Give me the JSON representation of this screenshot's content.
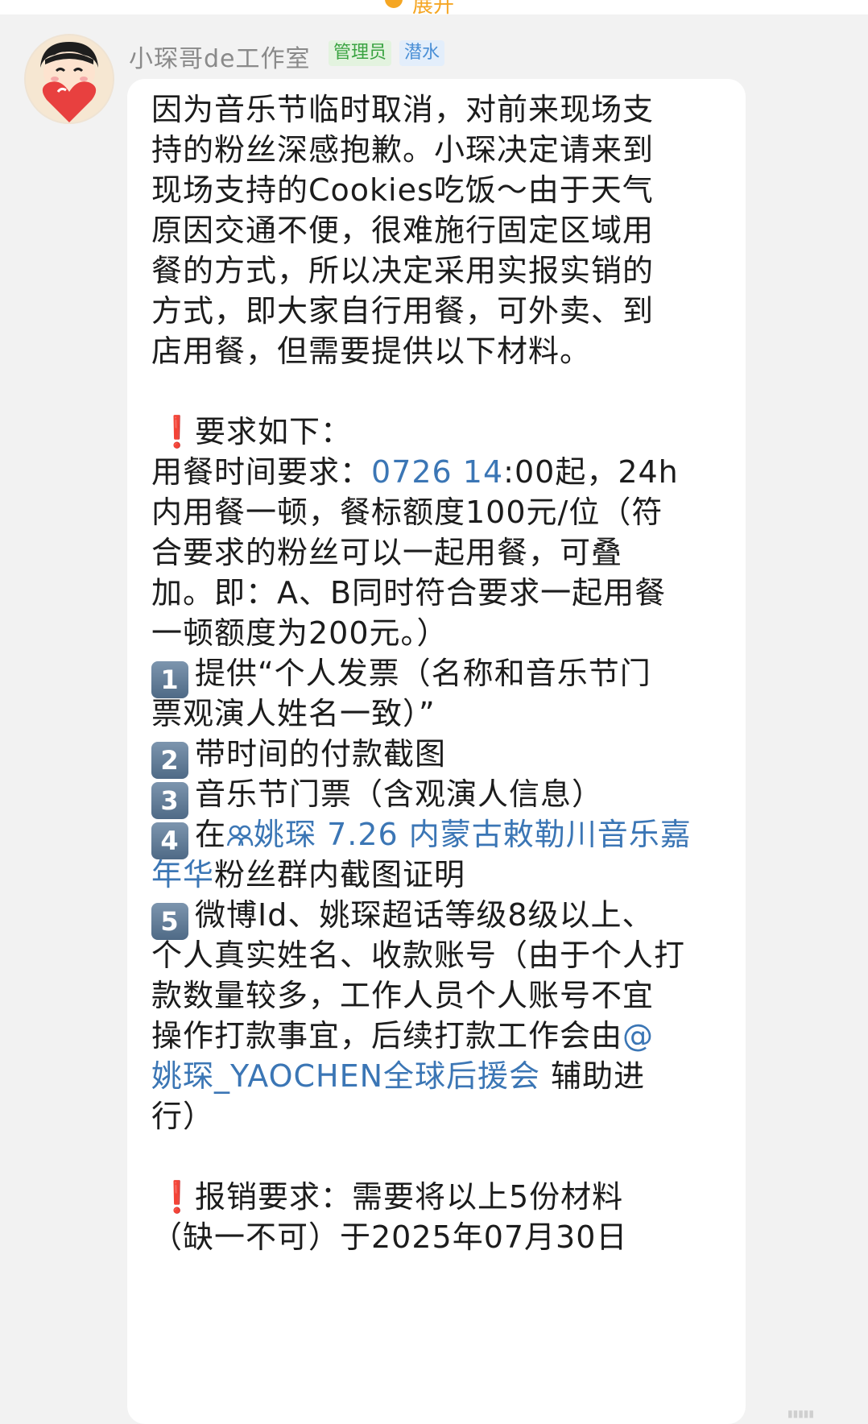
{
  "top_bar": {
    "expand_label": "展开"
  },
  "header": {
    "sender_name": "小琛哥de工作室",
    "badge_admin": "管理员",
    "badge_dive": "潜水"
  },
  "message": {
    "para1": [
      "因为音乐节临时取消，对前来现场支",
      "持的粉丝深感抱歉。小琛决定请来到",
      "现场支持的Cookies吃饭～由于天气",
      "原因交通不便，很难施行固定区域用",
      "餐的方式，所以决定采用实报实销的",
      "方式，即大家自行用餐，可外卖、到",
      "店用餐，但需要提供以下材料。"
    ],
    "exclaim_mark": "❗",
    "req_title": "要求如下：",
    "time_prefix": "用餐时间要求：",
    "time_link": "0726 14",
    "time_suffix": ":00起，24h",
    "req_lines": [
      "内用餐一顿，餐标额度100元/位（符",
      "合要求的粉丝可以一起用餐，可叠",
      "加。即：A、B同时符合要求一起用餐",
      "一顿额度为200元。）"
    ],
    "items": [
      {
        "num": "1",
        "text": "提供“个人发票（名称和音乐节门",
        "cont": "票观演人姓名一致）”"
      },
      {
        "num": "2",
        "text": "带时间的付款截图"
      },
      {
        "num": "3",
        "text": "音乐节门票（含观演人信息）"
      },
      {
        "num": "4",
        "prefix": "在",
        "group_icon": "group-chat-icon",
        "link_a": "姚琛 7.26 内蒙古敕勒川音乐嘉",
        "link_b": "年华",
        "suffix": "粉丝群内截图证明"
      },
      {
        "num": "5",
        "lines": [
          "微博Id、姚琛超话等级8级以上、",
          "个人真实姓名、收款账号（由于个人打",
          "款数量较多，工作人员个人账号不宜"
        ],
        "line4_text": "操作打款事宜，后续打款工作会由",
        "at_sign": "@",
        "mention": "姚琛_YAOCHEN全球后援会",
        "after_mention": " 辅助进",
        "last": "行）"
      }
    ],
    "reimb_title": "报销要求：需要将以上5份材料",
    "reimb_line2": "（缺一不可）于2025年07月30日"
  },
  "colors": {
    "link": "#3b76b5",
    "exclaim": "#e53935",
    "admin_badge": "#3aa341",
    "dive_badge": "#4a8fd6"
  }
}
